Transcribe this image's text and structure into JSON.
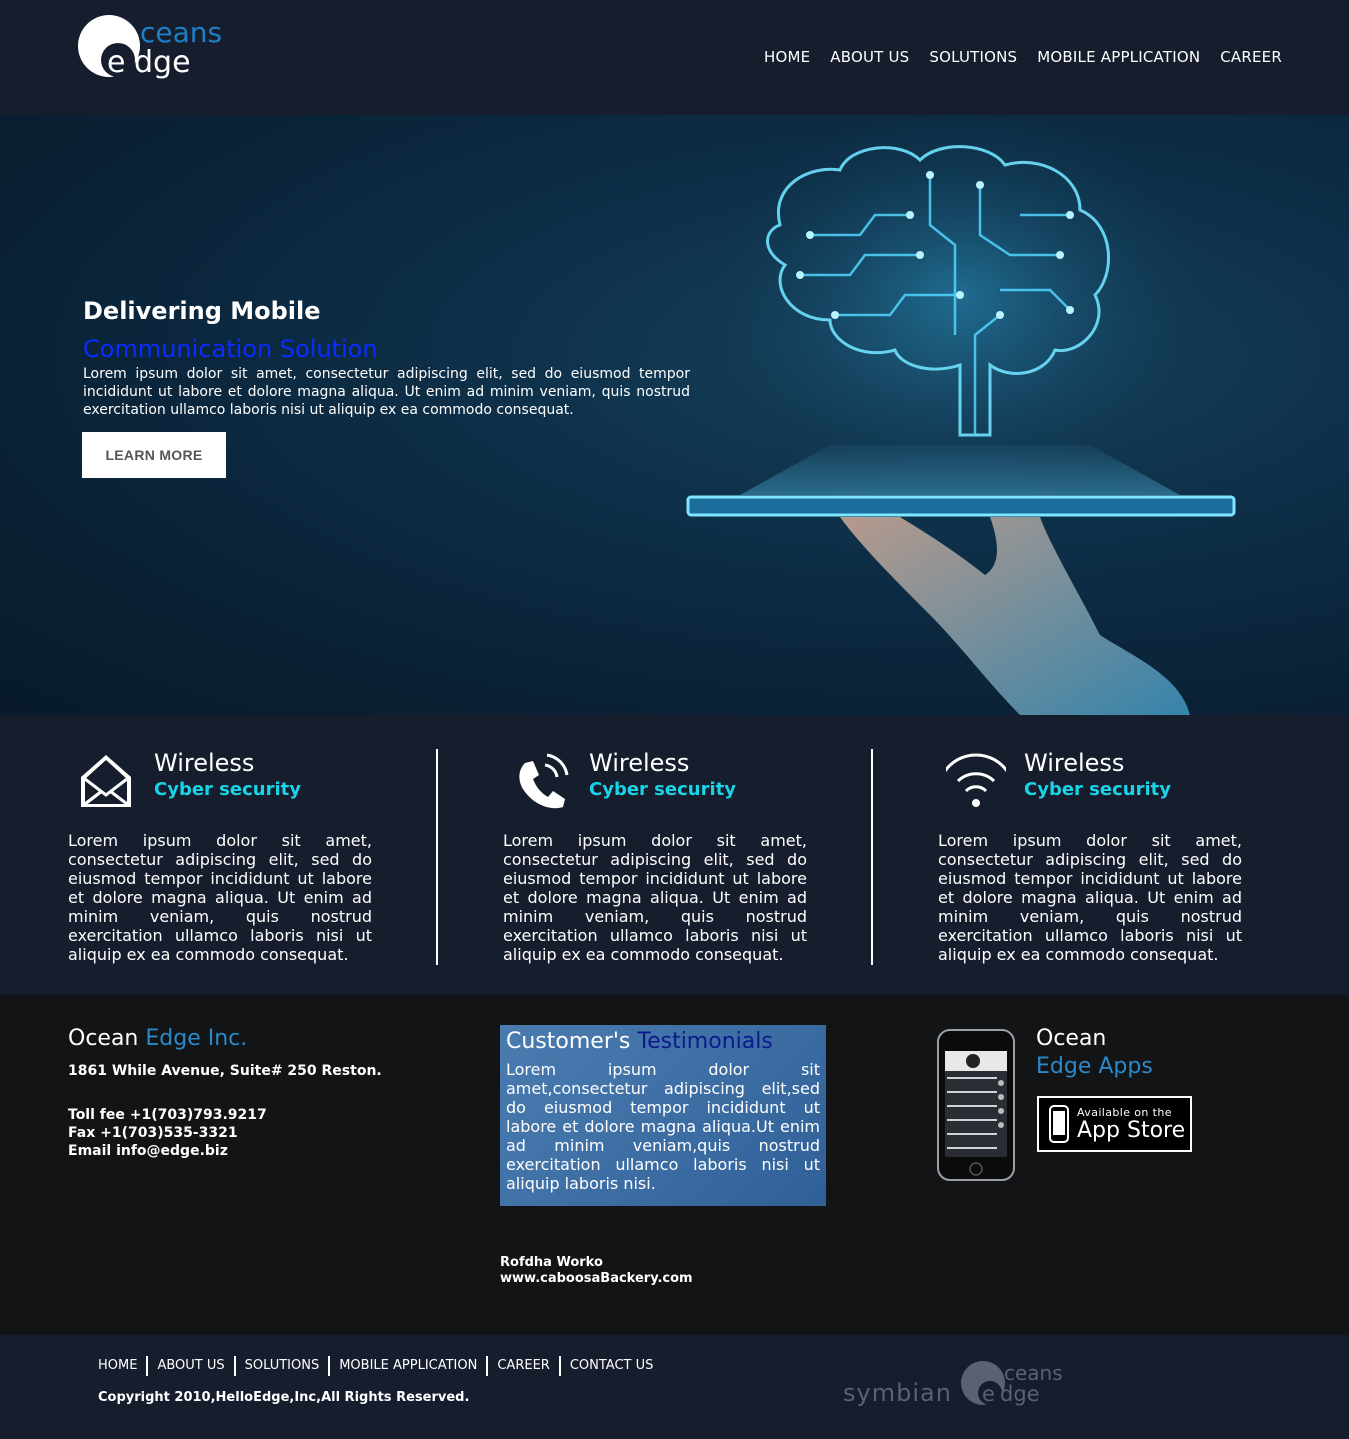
{
  "header": {
    "logo": {
      "top": "ceans",
      "bottom": "dge"
    },
    "nav": [
      "HOME",
      "ABOUT US",
      "SOLUTIONS",
      "MOBILE APPLICATION",
      "CAREER"
    ]
  },
  "hero": {
    "title": "Delivering Mobile",
    "subtitle": "Communication Solution",
    "text": "Lorem ipsum dolor sit amet, consectetur adipiscing elit, sed do eiusmod tempor incididunt ut labore et dolore magna aliqua. Ut enim ad minim veniam, quis nostrud exercitation ullamco laboris nisi ut aliquip ex ea commodo consequat.",
    "button": "LEARN MORE"
  },
  "features": [
    {
      "icon": "mail-icon",
      "title": "Wireless",
      "subtitle": "Cyber security",
      "text": "Lorem ipsum dolor sit amet, consectetur adipiscing elit, sed do eiusmod tempor incididunt ut labore et dolore magna aliqua. Ut enim ad minim veniam, quis nostrud exercitation ullamco laboris nisi ut aliquip ex ea commodo consequat."
    },
    {
      "icon": "phone-icon",
      "title": "Wireless",
      "subtitle": "Cyber security",
      "text": "Lorem ipsum dolor sit amet, consectetur adipiscing elit, sed do eiusmod tempor incididunt ut labore et dolore magna aliqua. Ut enim ad minim veniam, quis nostrud exercitation ullamco laboris nisi ut aliquip ex ea commodo consequat."
    },
    {
      "icon": "wifi-icon",
      "title": "Wireless",
      "subtitle": "Cyber security",
      "text": "Lorem ipsum dolor sit amet, consectetur adipiscing elit, sed do eiusmod tempor incididunt ut labore et dolore magna aliqua. Ut enim ad minim veniam, quis nostrud exercitation ullamco laboris nisi ut aliquip ex ea commodo consequat."
    }
  ],
  "company": {
    "title_main": "Ocean",
    "title_accent": "Edge Inc.",
    "address": "1861 While Avenue, Suite# 250 Reston.",
    "toll": "Toll fee +1(703)793.9217",
    "fax": "Fax +1(703)535-3321",
    "email": "Email info@edge.biz"
  },
  "testimonials": {
    "title_main": "Customer's",
    "title_accent": "Testimonials",
    "text": "Lorem ipsum dolor sit amet,consectetur adipiscing elit,sed do eiusmod tempor incididunt ut labore et dolore magna aliqua.Ut enim ad minim veniam,quis nostrud exercitation ullamco laboris nisi ut aliquip laboris nisi.",
    "author": "Rofdha Worko",
    "site": "www.caboosaBackery.com"
  },
  "apps": {
    "title": "Ocean",
    "subtitle": "Edge Apps",
    "store_line1": "Available on the",
    "store_line2": "App Store"
  },
  "footer": {
    "nav": [
      "HOME",
      "ABOUT US",
      "SOLUTIONS",
      "MOBILE APPLICATION",
      "CAREER",
      "CONTACT US"
    ],
    "copyright": "Copyright 2010,HelloEdge,Inc,All Rights Reserved.",
    "partner": "symbian",
    "logo": {
      "top": "ceans",
      "bottom": "dge"
    }
  },
  "colors": {
    "accent": "#19d3e6",
    "brand_blue": "#2b89c9",
    "hero_sub": "#0b2bff"
  }
}
